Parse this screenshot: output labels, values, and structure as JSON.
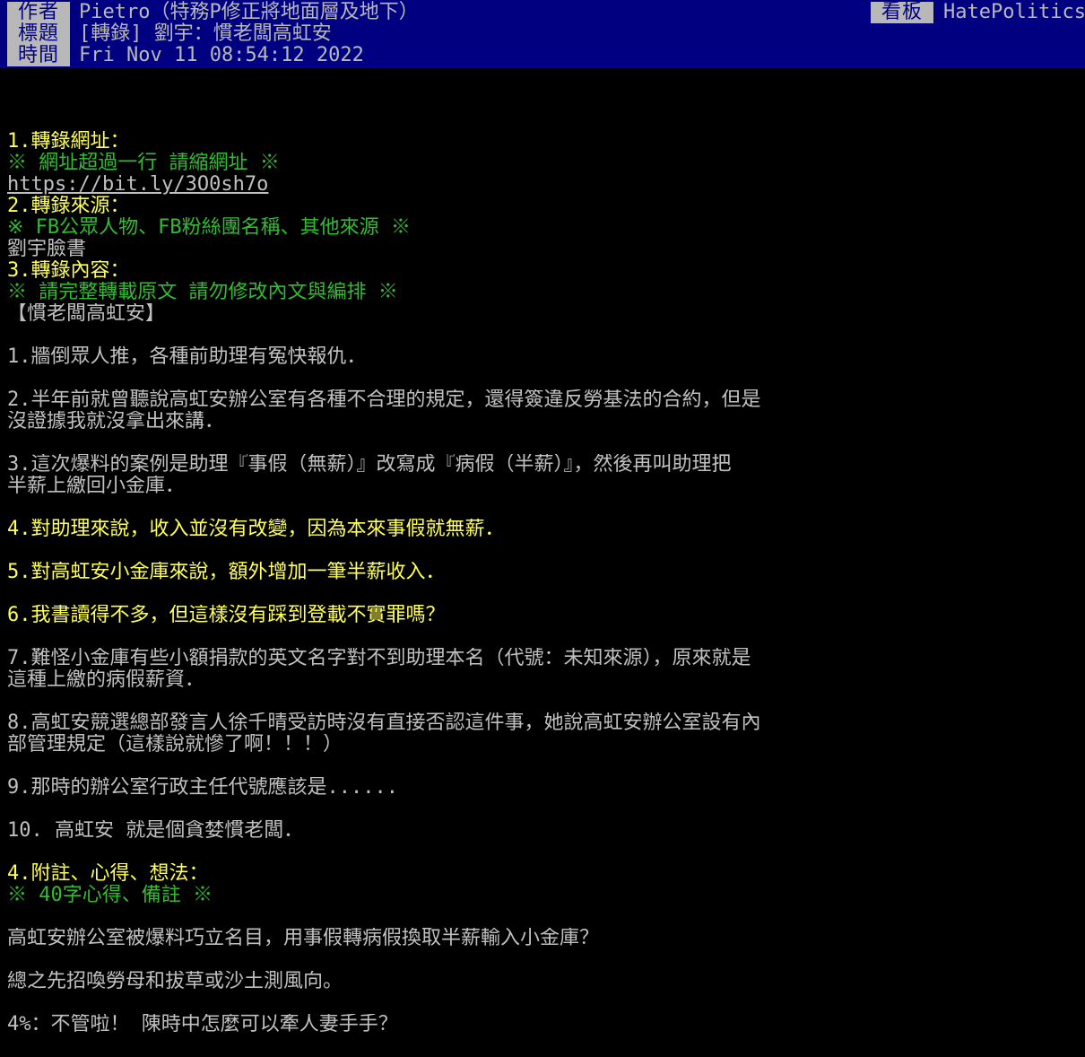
{
  "header": {
    "author_label": "作者",
    "author_value": "Pietro（特務P修正將地面層及地下）",
    "title_label": "標題",
    "title_value": "[轉錄] 劉宇：慣老闆高虹安",
    "time_label": "時間",
    "time_value": "Fri Nov 11 08:54:12 2022",
    "board_label": "看板",
    "board_value": "HatePolitics"
  },
  "body": {
    "s1_heading": "1.轉錄網址：",
    "s1_hint": "※ 網址超過一行 請縮網址 ※",
    "s1_url": "https://bit.ly/3O0sh7o",
    "s2_heading": "2.轉錄來源：",
    "s2_hint": "※ FB公眾人物、FB粉絲團名稱、其他來源 ※",
    "s2_value": "劉宇臉書",
    "s3_heading": "3.轉錄內容：",
    "s3_hint": "※ 請完整轉載原文 請勿修改內文與編排 ※",
    "s3_title": "【慣老闆高虹安】",
    "p1": "1.牆倒眾人推，各種前助理有冤快報仇．",
    "p2_a": "2.半年前就曾聽說高虹安辦公室有各種不合理的規定，還得簽違反勞基法的合約，但是",
    "p2_b": "沒證據我就沒拿出來講．",
    "p3_a": "3.這次爆料的案例是助理『事假（無薪）』改寫成『病假（半薪）』，然後再叫助理把",
    "p3_b": "半薪上繳回小金庫．",
    "p4": "4.對助理來說，收入並沒有改變，因為本來事假就無薪．",
    "p5": "5.對高虹安小金庫來說，額外增加一筆半薪收入．",
    "p6": "6.我書讀得不多，但這樣沒有踩到登載不實罪嗎？",
    "p7_a": "7.難怪小金庫有些小額捐款的英文名字對不到助理本名（代號：未知來源），原來就是",
    "p7_b": "這種上繳的病假薪資．",
    "p8_a": "8.高虹安競選總部發言人徐千晴受訪時沒有直接否認這件事，她說高虹安辦公室設有內",
    "p8_b": "部管理規定（這樣說就慘了啊！！！）",
    "p9": "9.那時的辦公室行政主任代號應該是......",
    "p10": "10. 高虹安 就是個貪婪慣老闆．",
    "s4_heading": "4.附註、心得、想法：",
    "s4_hint": "※ 40字心得、備註 ※",
    "c1": "高虹安辦公室被爆料巧立名目，用事假轉病假換取半薪輸入小金庫？",
    "c2": "總之先招喚勞母和拔草或沙土測風向。",
    "c3": "4%：不管啦！ 陳時中怎麼可以牽人妻手手？"
  },
  "colors": {
    "background": "#000000",
    "header_bg": "#000080",
    "header_label_bg": "#b8b8b8",
    "text_gray": "#c0c0c0",
    "text_yellow": "#ffff55",
    "text_green": "#33bb33"
  }
}
